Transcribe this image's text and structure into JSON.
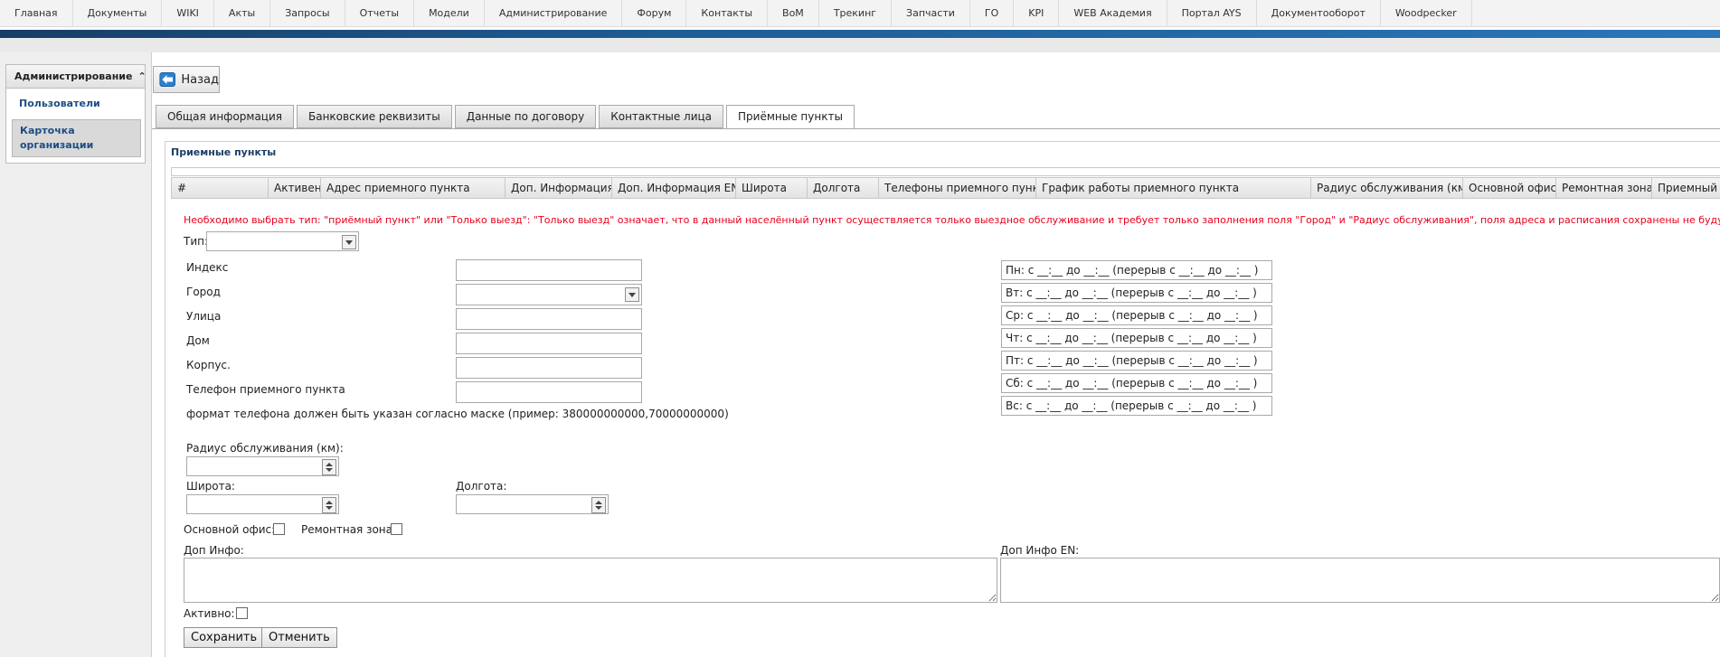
{
  "topmenu": {
    "items": [
      "Главная",
      "Документы",
      "WIKI",
      "Акты",
      "Запросы",
      "Отчеты",
      "Модели",
      "Администрирование",
      "Форум",
      "Контакты",
      "BoM",
      "Трекинг",
      "Запчасти",
      "ГО",
      "KPI",
      "WEB Академия",
      "Портал AYS",
      "Документооборот",
      "Woodpecker"
    ]
  },
  "sidebar": {
    "title": "Администрирование",
    "title_icon": "double-chevron-up-icon",
    "items": [
      "Пользователи",
      "Карточка организации"
    ]
  },
  "back_button": {
    "label": "Назад",
    "icon": "back-arrow-icon"
  },
  "tabs": [
    "Общая информация",
    "Банковские реквизиты",
    "Данные по договору",
    "Контактные лица",
    "Приёмные пункты"
  ],
  "active_tab": "Приёмные пункты",
  "panel": {
    "title": "Приемные пункты",
    "columns": [
      "#",
      "Активен",
      "Адрес приемного пункта",
      "Доп. Информация",
      "Доп. Информация EN",
      "Широта",
      "Долгота",
      "Телефоны приемного пункта",
      "График работы приемного пункта",
      "Радиус обслуживания (км)",
      "Основной офис",
      "Ремонтная зона",
      "Приемный"
    ]
  },
  "form": {
    "warning": "Необходимо выбрать тип: \"приёмный пункт\" или \"Только выезд\": \"Только выезд\" означает, что в данный населённый пункт осуществляется только выездное обслуживание и требует только заполнения поля \"Город\" и \"Радиус обслуживания\", поля адреса и расписания сохранены не будут!",
    "type_label": "Тип:",
    "type_value": "",
    "index_label": "Индекс",
    "index_value": "",
    "city_label": "Город",
    "city_value": "",
    "street_label": "Улица",
    "street_value": "",
    "house_label": "Дом",
    "house_value": "",
    "building_label": "Корпус.",
    "building_value": "",
    "phone_label": "Телефон приемного пункта",
    "phone_value": "",
    "phone_hint": "формат телефона должен быть указан согласно маске (пример: 380000000000,70000000000)",
    "radius_label": "Радиус обслуживания (км):",
    "radius_value": "",
    "lat_label": "Широта:",
    "lat_value": "",
    "lon_label": "Долгота:",
    "lon_value": "",
    "main_office_label": "Основной офис:",
    "repair_zone_label": "Ремонтная зона:",
    "info_label": "Доп Инфо:",
    "info_value": "",
    "info_en_label": "Доп Инфо EN:",
    "info_en_value": "",
    "active_label": "Активно:",
    "save_label": "Сохранить",
    "cancel_label": "Отменить"
  },
  "schedule": [
    "Пн: с __:__ до __:__ (перерыв с __:__ до __:__ )",
    "Вт: с __:__ до __:__ (перерыв с __:__ до __:__ )",
    "Ср: с __:__ до __:__ (перерыв с __:__ до __:__ )",
    "Чт: с __:__ до __:__ (перерыв с __:__ до __:__ )",
    "Пт: с __:__ до __:__ (перерыв с __:__ до __:__ )",
    "Сб: с __:__ до __:__ (перерыв с __:__ до __:__ )",
    "Вс: с __:__ до __:__ (перерыв с __:__ до __:__ )"
  ],
  "colors": {
    "accent_blue": "#1f5d94",
    "warning_red": "#e8001c",
    "link_blue": "#1c4e84"
  }
}
